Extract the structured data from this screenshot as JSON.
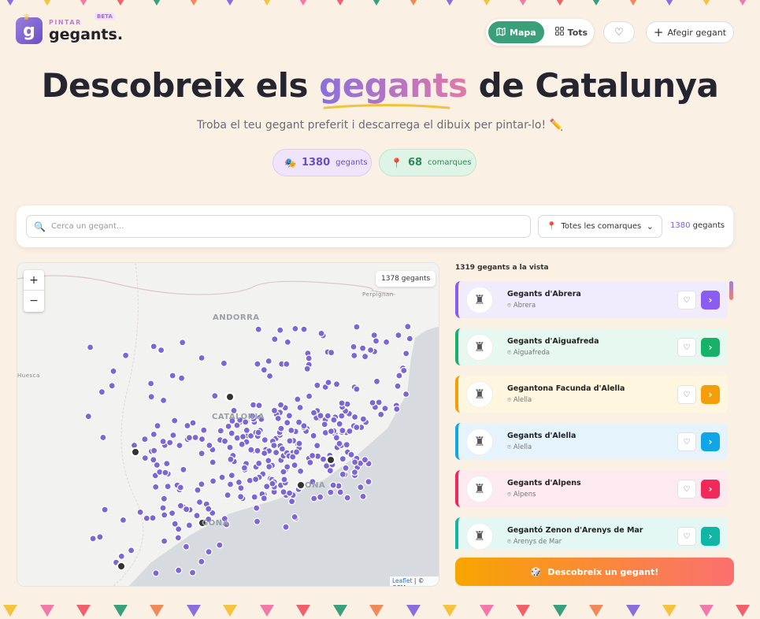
{
  "brand": {
    "small": "PINTAR",
    "name": "gegants.",
    "badge": "BETA",
    "letter": "g"
  },
  "view_toggle": {
    "map_label": "Mapa",
    "all_label": "Tots"
  },
  "header": {
    "add_label": "Afegir gegant"
  },
  "hero": {
    "title_pre": "Descobreix els ",
    "title_accent": "gegants",
    "title_post": " de Catalunya",
    "subtitle": "Troba el teu gegant preferit i descarrega el dibuix per pintar-lo! ✏️"
  },
  "stats": {
    "gegants_count": "1380",
    "gegants_label": "gegants",
    "comarques_count": "68",
    "comarques_label": "comarques"
  },
  "search": {
    "placeholder": "Cerca un gegant...",
    "comarca_select": "Totes les comarques",
    "total_count": "1380",
    "total_label": "gegants"
  },
  "map": {
    "badge": "1378 gegants",
    "zoom_in": "+",
    "zoom_out": "−",
    "labels": {
      "andorra": "ANDORRA",
      "catalonia": "CATALONIA",
      "huesca": "Huesca",
      "perpignan": "Perpignan",
      "barcelona": "ONA",
      "tarragona": "GONA"
    },
    "attribution_link": "Leaflet",
    "attribution_rest": " | © OSM",
    "marker_color": "#7c66d6"
  },
  "list": {
    "header": "1319 gegants a la vista",
    "items": [
      {
        "title": "Gegants d'Abrera",
        "location": "Abrera",
        "accent": "#8a5cf0",
        "bg": "#f1ecfd"
      },
      {
        "title": "Gegants d'Aiguafreda",
        "location": "Aiguafreda",
        "accent": "#17b26a",
        "bg": "#e6f8ef"
      },
      {
        "title": "Gegantona Facunda d'Alella",
        "location": "Alella",
        "accent": "#f59e0b",
        "bg": "#fff6e0"
      },
      {
        "title": "Gegants d'Alella",
        "location": "Alella",
        "accent": "#0ea5e9",
        "bg": "#e5f4fc"
      },
      {
        "title": "Gegants d'Alpens",
        "location": "Alpens",
        "accent": "#f0295a",
        "bg": "#fdeaf0"
      },
      {
        "title": "Gegantó Zenon d'Arenys de Mar",
        "location": "Arenys de Mar",
        "accent": "#0fb5a5",
        "bg": "#e3f7f4"
      }
    ]
  },
  "discover": {
    "label": "Descobreix un gegant!"
  }
}
